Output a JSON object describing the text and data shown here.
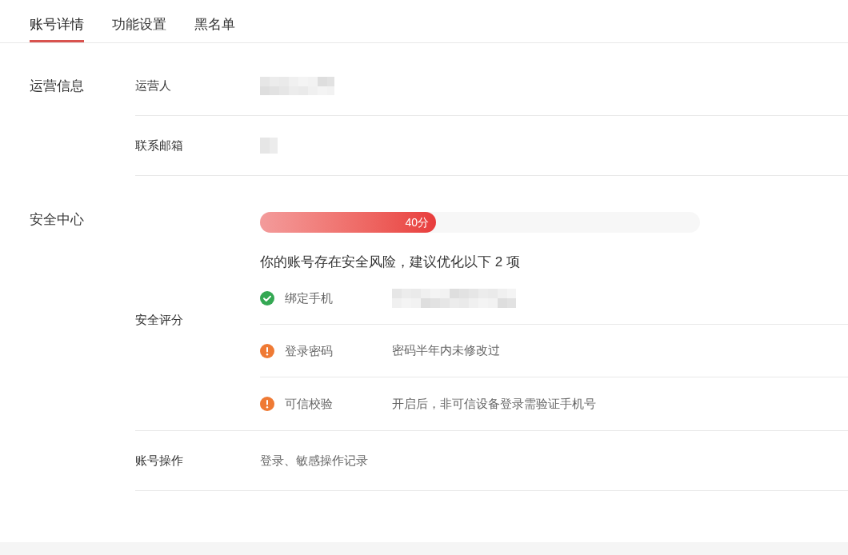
{
  "tabs": [
    {
      "label": "账号详情",
      "selected": true
    },
    {
      "label": "功能设置",
      "selected": false
    },
    {
      "label": "黑名单",
      "selected": false
    }
  ],
  "sections": [
    {
      "title": "运营信息",
      "rows": [
        {
          "kind": "redacted",
          "label": "运营人"
        },
        {
          "kind": "redacted",
          "label": "联系邮箱"
        }
      ]
    },
    {
      "title": "安全中心",
      "rows": [
        {
          "kind": "score",
          "label": "安全评分",
          "score": {
            "level": 0.4,
            "reading": "40分"
          },
          "summary": "你的账号存在安全风险，建议优化以下 2 项",
          "items": [
            {
              "label": "绑定手机",
              "done": true,
              "kind": "redacted"
            },
            {
              "label": "登录密码",
              "done": false,
              "kind": "text",
              "value": "密码半年内未修改过"
            },
            {
              "label": "可信校验",
              "done": false,
              "kind": "text",
              "value": "开启后，非可信设备登录需验证手机号"
            }
          ]
        },
        {
          "kind": "text",
          "label": "账号操作",
          "value": "登录、敏感操作记录"
        }
      ]
    }
  ]
}
